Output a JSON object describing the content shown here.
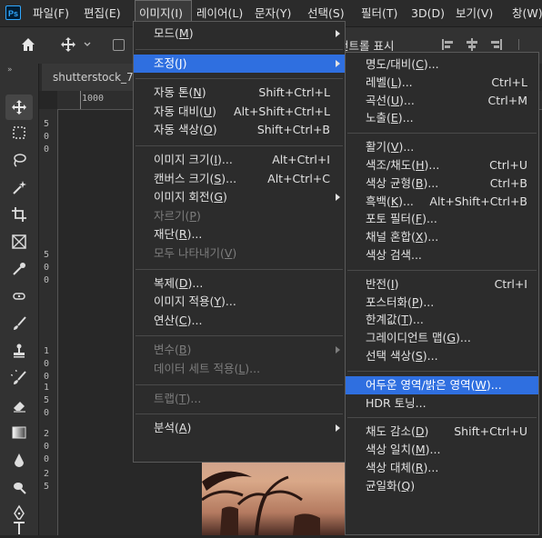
{
  "menubar": {
    "logo": "Ps",
    "items": [
      "파일(F)",
      "편집(E)",
      "이미지(I)",
      "레이어(L)",
      "문자(Y)",
      "선택(S)",
      "필터(T)",
      "3D(D)",
      "보기(V)",
      "창(W)"
    ]
  },
  "options_bar": {
    "partial_text": "컨트롤 표시"
  },
  "document": {
    "tab_title": "shutterstock_7",
    "ruler_top": "1000"
  },
  "ruler_left_digits": [
    "5",
    "0",
    "0",
    "5",
    "0",
    "0",
    "1",
    "0",
    "0",
    "1",
    "5",
    "0",
    "2",
    "0",
    "0",
    "2",
    "5"
  ],
  "image_menu": [
    {
      "label": "모드(M)",
      "shortcut": "",
      "submenu": true
    },
    {
      "sep": true
    },
    {
      "label": "조정(J)",
      "shortcut": "",
      "submenu": true,
      "highlight": true
    },
    {
      "sep": true
    },
    {
      "label": "자동 톤(N)",
      "shortcut": "Shift+Ctrl+L"
    },
    {
      "label": "자동 대비(U)",
      "shortcut": "Alt+Shift+Ctrl+L"
    },
    {
      "label": "자동 색상(O)",
      "shortcut": "Shift+Ctrl+B"
    },
    {
      "sep": true
    },
    {
      "label": "이미지 크기(I)...",
      "shortcut": "Alt+Ctrl+I"
    },
    {
      "label": "캔버스 크기(S)...",
      "shortcut": "Alt+Ctrl+C"
    },
    {
      "label": "이미지 회전(G)",
      "shortcut": "",
      "submenu": true
    },
    {
      "label": "자르기(P)",
      "shortcut": "",
      "disabled": true
    },
    {
      "label": "재단(R)...",
      "shortcut": ""
    },
    {
      "label": "모두 나타내기(V)",
      "shortcut": "",
      "disabled": true
    },
    {
      "sep": true
    },
    {
      "label": "복제(D)...",
      "shortcut": ""
    },
    {
      "label": "이미지 적용(Y)...",
      "shortcut": ""
    },
    {
      "label": "연산(C)...",
      "shortcut": ""
    },
    {
      "sep": true
    },
    {
      "label": "변수(B)",
      "shortcut": "",
      "submenu": true,
      "disabled": true
    },
    {
      "label": "데이터 세트 적용(L)...",
      "shortcut": "",
      "disabled": true
    },
    {
      "sep": true
    },
    {
      "label": "트랩(T)...",
      "shortcut": "",
      "disabled": true
    },
    {
      "sep": true
    },
    {
      "label": "분석(A)",
      "shortcut": "",
      "submenu": true
    }
  ],
  "adjust_menu": [
    {
      "label": "명도/대비(C)...",
      "shortcut": ""
    },
    {
      "label": "레벨(L)...",
      "shortcut": "Ctrl+L"
    },
    {
      "label": "곡선(U)...",
      "shortcut": "Ctrl+M"
    },
    {
      "label": "노출(E)...",
      "shortcut": ""
    },
    {
      "sep": true
    },
    {
      "label": "활기(V)...",
      "shortcut": ""
    },
    {
      "label": "색조/채도(H)...",
      "shortcut": "Ctrl+U"
    },
    {
      "label": "색상 균형(B)...",
      "shortcut": "Ctrl+B"
    },
    {
      "label": "흑백(K)...",
      "shortcut": "Alt+Shift+Ctrl+B"
    },
    {
      "label": "포토 필터(F)...",
      "shortcut": ""
    },
    {
      "label": "채널 혼합(X)...",
      "shortcut": ""
    },
    {
      "label": "색상 검색...",
      "shortcut": ""
    },
    {
      "sep": true
    },
    {
      "label": "반전(I)",
      "shortcut": "Ctrl+I"
    },
    {
      "label": "포스터화(P)...",
      "shortcut": ""
    },
    {
      "label": "한계값(T)...",
      "shortcut": ""
    },
    {
      "label": "그레이디언트 맵(G)...",
      "shortcut": ""
    },
    {
      "label": "선택 색상(S)...",
      "shortcut": ""
    },
    {
      "sep": true
    },
    {
      "label": "어두운 영역/밝은 영역(W)...",
      "shortcut": "",
      "highlight": true
    },
    {
      "label": "HDR 토닝...",
      "shortcut": ""
    },
    {
      "sep": true
    },
    {
      "label": "채도 감소(D)",
      "shortcut": "Shift+Ctrl+U"
    },
    {
      "label": "색상 일치(M)...",
      "shortcut": ""
    },
    {
      "label": "색상 대체(R)...",
      "shortcut": ""
    },
    {
      "label": "균일화(Q)",
      "shortcut": ""
    }
  ],
  "colors": {
    "highlight": "#2f6fe0",
    "menu_bg": "#2c2c2c",
    "app_bg": "#262626"
  }
}
